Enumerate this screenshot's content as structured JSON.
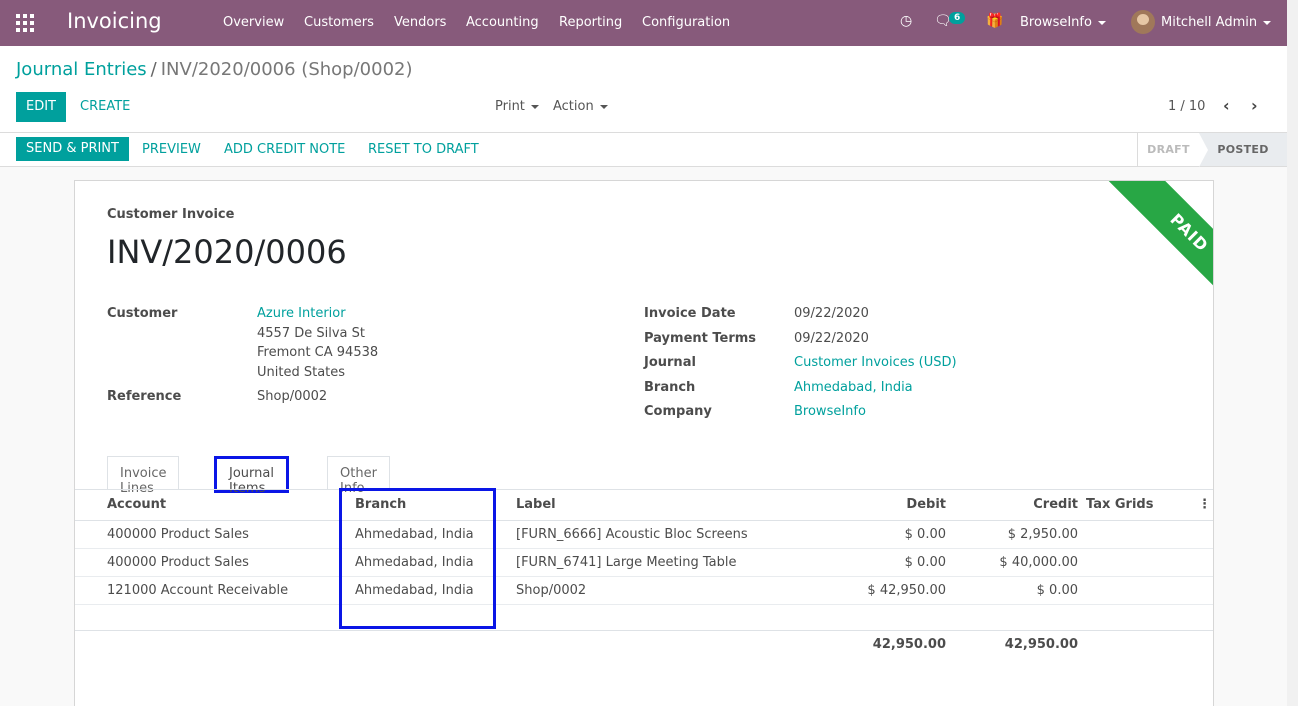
{
  "navbar": {
    "app_name": "Invoicing",
    "menus": [
      "Overview",
      "Customers",
      "Vendors",
      "Accounting",
      "Reporting",
      "Configuration"
    ],
    "message_count": "6",
    "company": "BrowseInfo",
    "user": "Mitchell Admin"
  },
  "control_panel": {
    "breadcrumb_parent": "Journal Entries",
    "breadcrumb_separator": "/",
    "breadcrumb_current": "INV/2020/0006 (Shop/0002)",
    "edit_label": "EDIT",
    "create_label": "CREATE",
    "print_label": "Print",
    "action_label": "Action",
    "pager": "1 / 10"
  },
  "statusbar": {
    "send_print_label": "SEND & PRINT",
    "preview_label": "PREVIEW",
    "credit_note_label": "ADD CREDIT NOTE",
    "reset_label": "RESET TO DRAFT",
    "stage_draft": "DRAFT",
    "stage_posted": "POSTED"
  },
  "invoice": {
    "ribbon": "PAID",
    "type": "Customer Invoice",
    "name": "INV/2020/0006",
    "customer_label": "Customer",
    "customer_name": "Azure Interior",
    "address_line1": "4557 De Silva St",
    "address_line2": "Fremont CA 94538",
    "address_line3": "United States",
    "reference_label": "Reference",
    "reference": "Shop/0002",
    "invoice_date_label": "Invoice Date",
    "invoice_date": "09/22/2020",
    "payment_terms_label": "Payment Terms",
    "payment_terms": "09/22/2020",
    "journal_label": "Journal",
    "journal": "Customer Invoices (USD)",
    "branch_label": "Branch",
    "branch": "Ahmedabad, India",
    "company_label": "Company",
    "company": "BrowseInfo"
  },
  "tabs": [
    "Invoice Lines",
    "Journal Items",
    "Other Info"
  ],
  "journal_items": {
    "columns": [
      "Account",
      "Branch",
      "Label",
      "Debit",
      "Credit",
      "Tax Grids"
    ],
    "rows": [
      [
        "400000 Product Sales",
        "Ahmedabad, India",
        "[FURN_6666] Acoustic Bloc Screens",
        "$ 0.00",
        "$ 2,950.00"
      ],
      [
        "400000 Product Sales",
        "Ahmedabad, India",
        "[FURN_6741] Large Meeting Table",
        "$ 0.00",
        "$ 40,000.00"
      ],
      [
        "121000 Account Receivable",
        "Ahmedabad, India",
        "Shop/0002",
        "$ 42,950.00",
        "$ 0.00"
      ]
    ],
    "total_debit": "42,950.00",
    "total_credit": "42,950.00"
  },
  "colors": {
    "navbar": "#875a7b",
    "primary": "#00a09d",
    "paid_ribbon": "#28a745",
    "highlight": "#0a16e6"
  }
}
